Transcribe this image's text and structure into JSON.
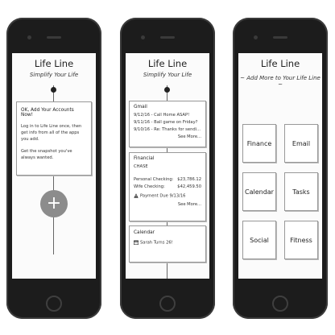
{
  "app": {
    "title": "Life Line",
    "subtitle": "Simplify Your Life"
  },
  "phone1": {
    "card_heading": "OK, Add Your Accounts Now!",
    "card_body_1": "Log in to Life Line once, then get info from all of the apps you add.",
    "card_body_2": "Get the snapshot you've always wanted.",
    "add_button_glyph": "+"
  },
  "phone2": {
    "gmail": {
      "title": "Gmail",
      "items": [
        "9/12/16 - Call Home ASAP!",
        "9/11/16 - Ball game on Friday?",
        "9/10/16 - Re: Thanks for sendi..."
      ],
      "see_more": "See More..."
    },
    "financial": {
      "title": "Financial",
      "bank": "CHASE",
      "accounts": [
        {
          "label": "Personal Checking:",
          "amount": "$23,786.12"
        },
        {
          "label": "Wife Checking:",
          "amount": "$42,459.50"
        }
      ],
      "payment_due": "Payment Due 9/13/16",
      "see_more": "See More..."
    },
    "calendar": {
      "title": "Calendar",
      "event": "Sarah Turns 26!"
    }
  },
  "phone3": {
    "prompt": "~ Add More to Your Life Line ~",
    "tiles": [
      "Finance",
      "Email",
      "Calendar",
      "Tasks",
      "Social",
      "Fitness"
    ]
  }
}
